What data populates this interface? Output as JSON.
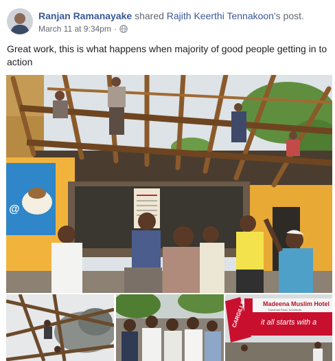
{
  "post": {
    "author": "Ranjan Ramanayake",
    "verb": "shared",
    "shared_from": "Rajith Keerthi Tennakoon",
    "suffix": "'s post.",
    "timestamp": "March 11 at 9:34pm",
    "separator": "·",
    "audience_icon": "globe-icon",
    "caption": "Great work, this is what happens when majority of good people getting in to action"
  },
  "photos": {
    "main": {
      "shop_sign_text": "@"
    },
    "thumb3": {
      "sign_brand": "CARGILLS",
      "sign_title": "Madeena Muslim Hotel",
      "sign_subtitle": "Thambala Road, Kirindiwita",
      "sign_tagline": "it all starts with a"
    }
  },
  "colors": {
    "link": "#385898",
    "meta": "#606770",
    "text": "#1c1e21",
    "sign_red": "#c8102e",
    "wall_yellow": "#f2b33d"
  }
}
